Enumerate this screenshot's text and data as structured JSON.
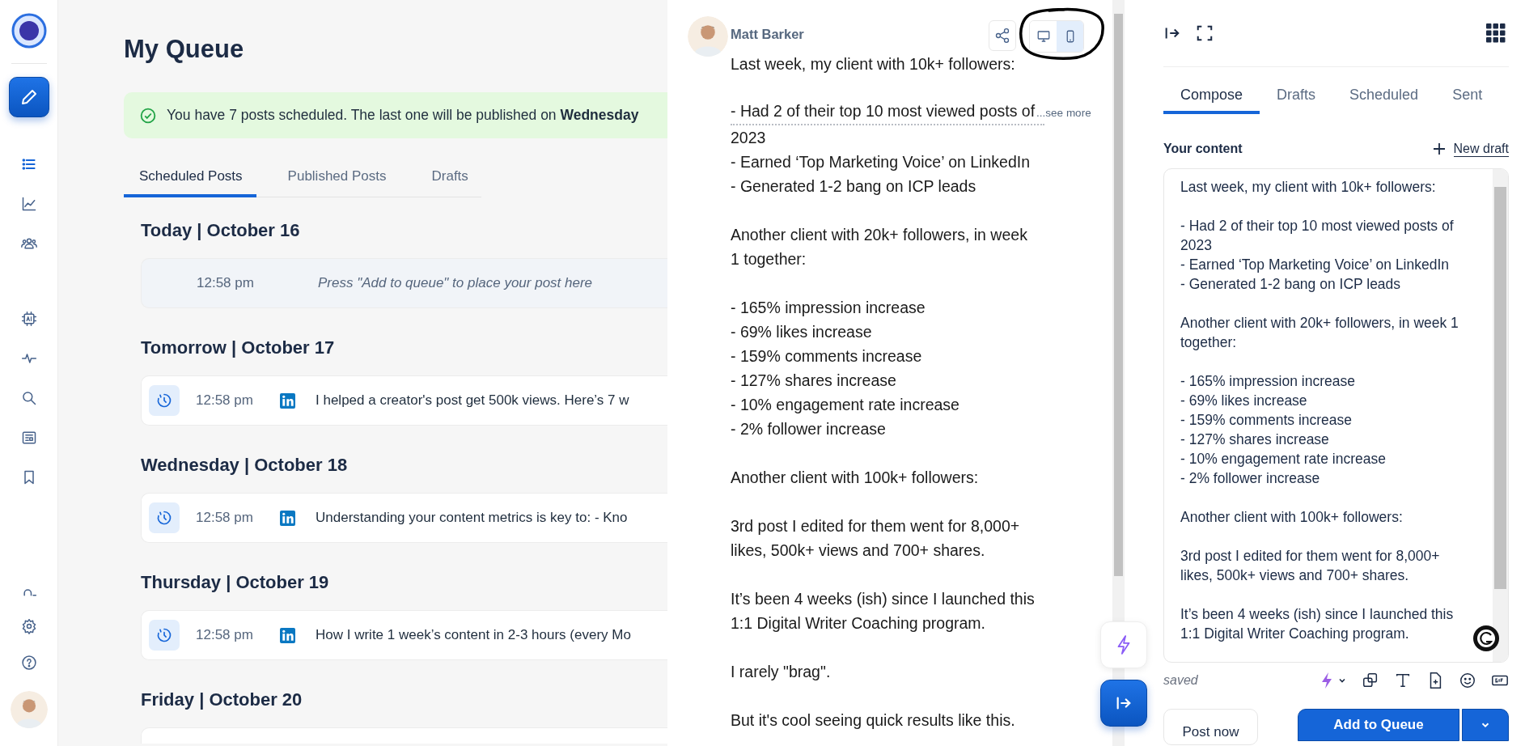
{
  "sidebar": {
    "nav": [
      {
        "kind": "list",
        "selected": true
      },
      {
        "kind": "chart",
        "selected": false
      },
      {
        "kind": "people",
        "selected": false
      },
      {
        "kind": "ai",
        "selected": false
      },
      {
        "kind": "pulse",
        "selected": false
      },
      {
        "kind": "search",
        "selected": false
      },
      {
        "kind": "news",
        "selected": false
      },
      {
        "kind": "bookmark",
        "selected": false
      }
    ],
    "bottom": [
      {
        "kind": "arc"
      },
      {
        "kind": "settings"
      },
      {
        "kind": "help"
      }
    ]
  },
  "queue": {
    "title": "My Queue",
    "banner": "You have 7 posts scheduled. The last one will be published on **Wednesday**",
    "tabs": [
      {
        "label": "Scheduled Posts",
        "selected": true
      },
      {
        "label": "Published Posts",
        "selected": false
      },
      {
        "label": "Drafts",
        "selected": false
      }
    ],
    "days": [
      {
        "heading": "Today | October 16",
        "slots": [
          {
            "kind": "empty",
            "time": "12:58 pm",
            "text": "Press \"Add to queue\" to place your post here"
          }
        ]
      },
      {
        "heading": "Tomorrow | October 17",
        "slots": [
          {
            "kind": "post",
            "time": "12:58 pm",
            "text": "I helped a creator's post get 500k views. Here’s 7 w"
          }
        ]
      },
      {
        "heading": "Wednesday | October 18",
        "slots": [
          {
            "kind": "post",
            "time": "12:58 pm",
            "text": "Understanding your content metrics is key to: - Kno"
          }
        ]
      },
      {
        "heading": "Thursday | October 19",
        "slots": [
          {
            "kind": "post",
            "time": "12:58 pm",
            "text": "How I write 1 week’s content in 2-3 hours (every Mo"
          }
        ]
      },
      {
        "heading": "Friday | October 20",
        "slots": [
          {
            "kind": "stub"
          }
        ]
      }
    ]
  },
  "preview": {
    "author": "Matt Barker",
    "views": [
      {
        "kind": "desktop",
        "selected": false
      },
      {
        "kind": "mobile",
        "selected": true
      }
    ],
    "blocks": [
      {
        "kind": "text",
        "text": "Last week, my client with 10k+ followers:"
      },
      {
        "kind": "fold",
        "text": "- Had 2 of their top 10 most viewed posts of",
        "link": "...see more",
        "rest": "2023\n- Earned ‘Top Marketing Voice’ on LinkedIn\n- Generated 1-2 bang on ICP leads"
      },
      {
        "kind": "text",
        "text": "Another client with 20k+ followers, in week 1 together:"
      },
      {
        "kind": "text",
        "text": "- 165% impression increase\n- 69% likes increase\n- 159% comments increase\n- 127% shares increase\n- 10% engagement rate increase\n- 2% follower increase"
      },
      {
        "kind": "text",
        "text": "Another client with 100k+ followers:"
      },
      {
        "kind": "text",
        "text": "3rd post I edited for them went for 8,000+ likes, 500k+ views and 700+ shares."
      },
      {
        "kind": "text",
        "text": "It’s been 4 weeks (ish) since I launched this 1:1 Digital Writer Coaching program."
      },
      {
        "kind": "text",
        "text": "I rarely \"brag\"."
      },
      {
        "kind": "text",
        "text": "But it's cool seeing quick results like this."
      }
    ]
  },
  "composer": {
    "tabs": [
      {
        "label": "Compose",
        "selected": true
      },
      {
        "label": "Drafts",
        "selected": false
      },
      {
        "label": "Scheduled",
        "selected": false
      },
      {
        "label": "Sent",
        "selected": false
      }
    ],
    "section_title": "Your content",
    "new_draft": "New draft",
    "content": "Last week, my client with 10k+ followers:\n\n- Had 2 of their top 10 most viewed posts of 2023\n- Earned ‘Top Marketing Voice’ on LinkedIn\n- Generated 1-2 bang on ICP leads\n\nAnother client with 20k+ followers, in week 1 together:\n\n- 165% impression increase\n- 69% likes increase\n- 159% comments increase\n- 127% shares increase\n- 10% engagement rate increase\n- 2% follower increase\n\nAnother client with 100k+ followers:\n\n3rd post I edited for them went for 8,000+ likes, 500k+ views and 700+ shares.\n\nIt’s been 4 weeks (ish) since I launched this 1:1 Digital Writer Coaching program.",
    "status": "saved",
    "post_now": "Post now",
    "add_to_queue": "Add to Queue"
  }
}
